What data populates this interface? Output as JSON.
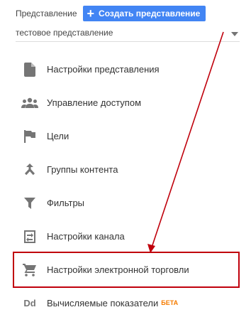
{
  "header": {
    "label": "Представление",
    "create_button": "Создать представление"
  },
  "view_select": {
    "value": "тестовое представление"
  },
  "menu": {
    "items": [
      {
        "label": "Настройки представления",
        "icon": "document-icon"
      },
      {
        "label": "Управление доступом",
        "icon": "people-icon"
      },
      {
        "label": "Цели",
        "icon": "flag-icon"
      },
      {
        "label": "Группы контента",
        "icon": "merge-icon"
      },
      {
        "label": "Фильтры",
        "icon": "filter-icon"
      },
      {
        "label": "Настройки канала",
        "icon": "channel-icon"
      },
      {
        "label": "Настройки электронной торговли",
        "icon": "cart-icon"
      },
      {
        "label": "Вычисляемые показатели",
        "icon": "dd-icon",
        "badge": "БЕТА"
      }
    ]
  },
  "annotation": {
    "arrow_color": "#c0000c",
    "highlight_color": "#c0000c"
  },
  "icons": {
    "dd_text": "Dd"
  }
}
